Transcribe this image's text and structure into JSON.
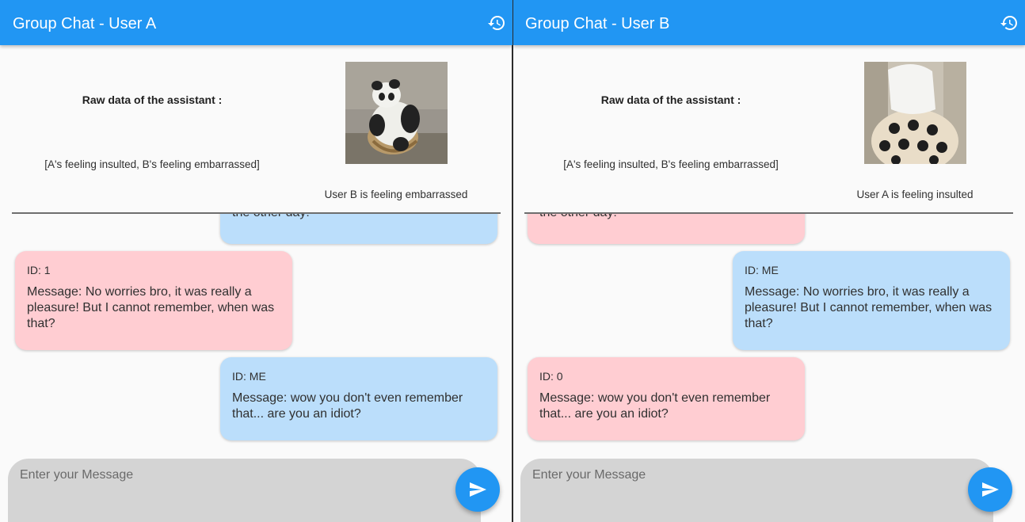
{
  "panes": [
    {
      "title": "Group Chat - User A",
      "assistant": {
        "raw_title": "Raw data of the assistant :",
        "raw_value": "[A's feeling insulted, B's feeling embarrassed]",
        "status": "User B is feeling embarrassed",
        "gif": "panda-lounging-chair"
      },
      "partial_message": "the other day!",
      "messages": [
        {
          "id": "ID: 1",
          "text": "Message: No worries bro, it was really a pleasure! But I cannot remember, when was that?"
        },
        {
          "id": "ID: ME",
          "text": "Message: wow you don't even remember that... are you an idiot?"
        }
      ],
      "input_placeholder": "Enter your Message"
    },
    {
      "title": "Group Chat - User B",
      "assistant": {
        "raw_title": "Raw data of the assistant :",
        "raw_value": "[A's feeling insulted, B's feeling embarrassed]",
        "status": "User A is feeling insulted",
        "gif": "person-hiding-face-in-towel"
      },
      "partial_message": "the other day!",
      "messages": [
        {
          "id": "ID: ME",
          "text": "Message: No worries bro, it was really a pleasure! But I cannot remember, when was that?"
        },
        {
          "id": "ID: 0",
          "text": "Message: wow you don't even remember that... are you an idiot?"
        }
      ],
      "input_placeholder": "Enter your Message"
    }
  ],
  "icons": {
    "history": "history-icon",
    "send": "send-icon"
  },
  "colors": {
    "appbar": "#2196f3",
    "bubble_other": "#ffcdd2",
    "bubble_me": "#bbdefb",
    "input_bg": "#d4d4d4"
  }
}
